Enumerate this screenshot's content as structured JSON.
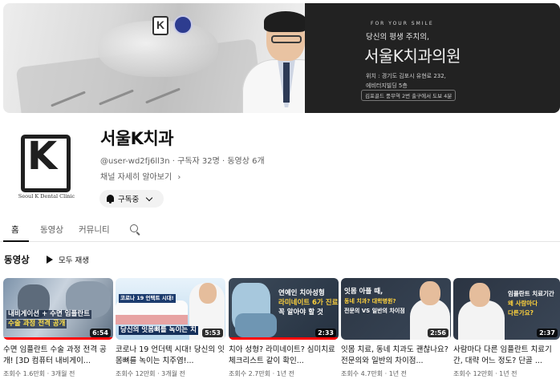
{
  "banner": {
    "tagline": "FOR YOUR SMILE",
    "subtitle": "당신의 평생 주치의,",
    "clinic_name": "서울K치과의원",
    "address_line1": "위치 : 경기도 김포시 유현로 232,",
    "address_line2": "에비터지빌딩 5층",
    "address_line3": "김포골드 풍무역 2번 출구에서 도보 4분"
  },
  "channel": {
    "name": "서울K치과",
    "avatar_caption": "Seoul K Dental Clinic",
    "meta": "@user-wd2fj6ll3n · 구독자 32명 · 동영상 6개",
    "more_label": "채널 자세히 알아보기",
    "subscribe_label": "구독중"
  },
  "tabs": [
    {
      "label": "홈",
      "active": true
    },
    {
      "label": "동영상",
      "active": false
    },
    {
      "label": "커뮤니티",
      "active": false
    }
  ],
  "section": {
    "title": "동영상",
    "play_all_label": "모두 재생"
  },
  "videos": [
    {
      "thumb_text": [
        "내비게이션 + 수면 임플란트",
        "수술 과정 전격 공개"
      ],
      "duration": "6:54",
      "progress": 1.0,
      "title": "수면 임플란트 수술 과정 전격 공개! [3D 컴퓨터 내비게이...",
      "meta": "조회수 1.6만회 · 3개월 전"
    },
    {
      "thumb_text": [
        "코로나 19 언택트 시대!",
        "당신의 잇몸뼈를 녹이는 치"
      ],
      "duration": "5:53",
      "progress": 0,
      "title": "코로나 19 언더텍 시대! 당신의 잇몸뼈를 녹이는 치주염!...",
      "meta": "조회수 12만회 · 3개월 전"
    },
    {
      "thumb_text": [
        "연예인 치아성형",
        "라미네이트 6가 진료",
        "꼭 알아야 할 것"
      ],
      "duration": "2:33",
      "progress": 1.0,
      "title": "치아 성형? 라미네이트? 심미치료 체크리스트 같이 확인...",
      "meta": "조회수 2.7만회 · 1년 전"
    },
    {
      "thumb_text": [
        "잇몸 아플 때,",
        "동네 치과? 대학병원?",
        "전문의 VS 일반의 차이점"
      ],
      "duration": "2:56",
      "progress": 0,
      "title": "잇몸 치료, 동네 치과도 괜찮나요? 전문의와 일반의 차이점...",
      "meta": "조회수 4.7만회 · 1년 전"
    },
    {
      "thumb_text": [
        "임플란트 치료기간",
        "왜 사람마다",
        "다른가요?"
      ],
      "duration": "2:37",
      "progress": 0,
      "title": "사람마다 다른 임플란트 치료기간, 대략 어느 정도? 단골 ...",
      "meta": "조회수 12만회 · 1년 전"
    }
  ],
  "colors": {
    "accent_red": "#ff0000",
    "banner_dark": "#222222",
    "text_secondary": "#606060"
  },
  "icons": {
    "bell": "bell-icon",
    "chevron": "chevron-down-icon",
    "search": "search-icon",
    "play": "play-icon",
    "more": "chevron-right-icon"
  }
}
